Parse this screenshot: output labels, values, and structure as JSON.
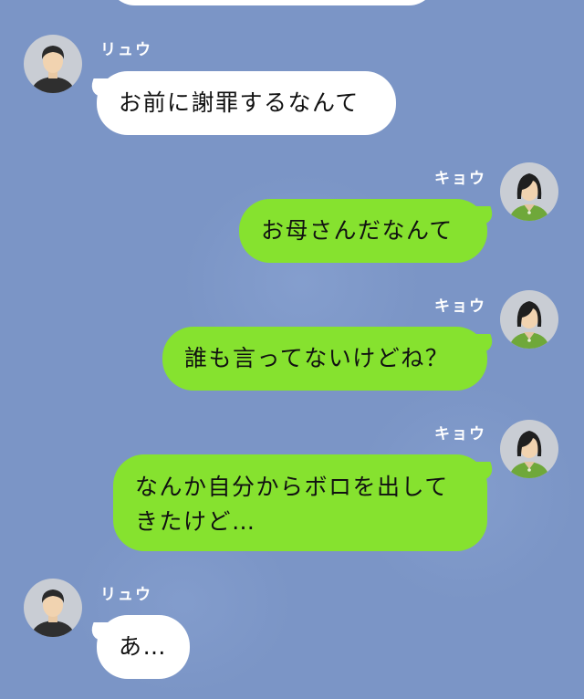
{
  "messages": [
    {
      "sender": "リュウ",
      "side": "left",
      "text": "お前に謝罪するなんて"
    },
    {
      "sender": "キョウ",
      "side": "right",
      "text": "お母さんだなんて"
    },
    {
      "sender": "キョウ",
      "side": "right",
      "text": "誰も言ってないけどね？"
    },
    {
      "sender": "キョウ",
      "side": "right",
      "lines": [
        "なんか自分からボロを出して",
        "きたけど…"
      ]
    },
    {
      "sender": "リュウ",
      "side": "left",
      "text": "あ…"
    }
  ],
  "colors": {
    "background": "#7b95c6",
    "outgoing_bubble": "#86e22f",
    "incoming_bubble": "#ffffff",
    "name_text": "#ffffff"
  },
  "icons": {
    "ryu_avatar": "man-avatar-icon",
    "kyou_avatar": "woman-avatar-icon"
  }
}
